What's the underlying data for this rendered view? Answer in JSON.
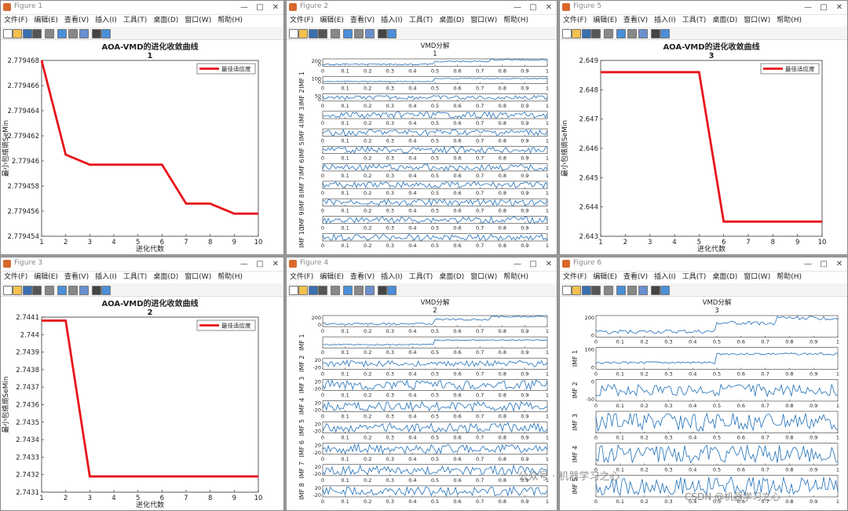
{
  "menu": [
    "文件(F)",
    "编辑(E)",
    "查看(V)",
    "插入(I)",
    "工具(T)",
    "桌面(D)",
    "窗口(W)",
    "帮助(H)"
  ],
  "colors": {
    "conv": "#e8151b",
    "imf": "#1f6fb8",
    "ax": "#333333"
  },
  "figures": [
    {
      "id": "fig1",
      "window_title": "Figure 1",
      "type": "convergence",
      "title": "AOA-VMD的进化收敛曲线",
      "subtitle": "1",
      "xlabel": "进化代数",
      "ylabel": "最小包络熵SeMin",
      "legend": "最佳适应度",
      "legend_position": "top-right",
      "x_ticks": [
        "1",
        "2",
        "3",
        "4",
        "5",
        "6",
        "7",
        "8",
        "9",
        "10"
      ],
      "y_ticks": [
        "2.779468",
        "2.779466",
        "2.779464",
        "2.779462",
        "2.77946",
        "2.779458",
        "2.779456",
        "2.779454"
      ],
      "chart_data": {
        "type": "line",
        "x": [
          1,
          2,
          3,
          4,
          5,
          6,
          7,
          8,
          9,
          10
        ],
        "y": [
          2.779468,
          2.7794605,
          2.7794597,
          2.7794597,
          2.7794597,
          2.7794597,
          2.7794566,
          2.7794566,
          2.7794558,
          2.7794558
        ],
        "ylim": [
          2.779454,
          2.779468
        ]
      }
    },
    {
      "id": "fig2",
      "window_title": "Figure 2",
      "type": "vmd",
      "title": "VMD分解",
      "subtitle": "1",
      "rows": [
        {
          "label": "",
          "ticks": [
            "200",
            "0"
          ]
        },
        {
          "label": "IMF 1",
          "ticks": [
            "100",
            "0"
          ]
        },
        {
          "label": "IMF 2",
          "ticks": [
            "50",
            "0"
          ]
        },
        {
          "label": "IMF 3",
          "ticks": [
            "",
            ""
          ]
        },
        {
          "label": "IMF 4",
          "ticks": [
            "",
            ""
          ]
        },
        {
          "label": "IMF 5",
          "ticks": [
            "",
            ""
          ]
        },
        {
          "label": "IMF 6",
          "ticks": [
            "",
            ""
          ]
        },
        {
          "label": "IMF 7",
          "ticks": [
            "",
            ""
          ]
        },
        {
          "label": "IMF 8",
          "ticks": [
            "",
            ""
          ]
        },
        {
          "label": "IMF 9",
          "ticks": [
            "",
            ""
          ]
        },
        {
          "label": "IMF 10",
          "ticks": [
            "",
            ""
          ]
        }
      ],
      "x_ticks": [
        "0",
        "0.1",
        "0.2",
        "0.3",
        "0.4",
        "0.5",
        "0.6",
        "0.7",
        "0.8",
        "0.9",
        "1"
      ]
    },
    {
      "id": "fig5",
      "window_title": "Figure 5",
      "type": "convergence",
      "title": "AOA-VMD的进化收敛曲线",
      "subtitle": "3",
      "xlabel": "进化代数",
      "ylabel": "最小包络熵SeMin",
      "legend": "最佳适应度",
      "legend_position": "top-right",
      "x_ticks": [
        "1",
        "2",
        "3",
        "4",
        "5",
        "6",
        "7",
        "8",
        "9",
        "10"
      ],
      "y_ticks": [
        "2.649",
        "2.648",
        "2.647",
        "2.646",
        "2.645",
        "2.644",
        "2.643"
      ],
      "chart_data": {
        "type": "line",
        "x": [
          1,
          2,
          3,
          4,
          5,
          6,
          7,
          8,
          9,
          10
        ],
        "y": [
          2.6486,
          2.6486,
          2.6486,
          2.6486,
          2.6486,
          2.6435,
          2.6435,
          2.6435,
          2.6435,
          2.6435
        ],
        "ylim": [
          2.643,
          2.649
        ]
      }
    },
    {
      "id": "fig3",
      "window_title": "Figure 3",
      "type": "convergence",
      "title": "AOA-VMD的进化收敛曲线",
      "subtitle": "2",
      "xlabel": "进化代数",
      "ylabel": "最小包络熵SeMin",
      "legend": "最佳适应度",
      "legend_position": "top-right",
      "x_ticks": [
        "1",
        "2",
        "3",
        "4",
        "5",
        "6",
        "7",
        "8",
        "9",
        "10"
      ],
      "y_ticks": [
        "2.7441",
        "2.744",
        "2.7439",
        "2.7438",
        "2.7437",
        "2.7436",
        "2.7435",
        "2.7434",
        "2.7433",
        "2.7432",
        "2.7431"
      ],
      "chart_data": {
        "type": "line",
        "x": [
          1,
          2,
          3,
          4,
          5,
          6,
          7,
          8,
          9,
          10
        ],
        "y": [
          2.74408,
          2.74408,
          2.74319,
          2.74319,
          2.74319,
          2.74319,
          2.74319,
          2.74319,
          2.74319,
          2.74319
        ],
        "ylim": [
          2.7431,
          2.7441
        ]
      }
    },
    {
      "id": "fig4",
      "window_title": "Figure 4",
      "type": "vmd",
      "title": "VMD分解",
      "subtitle": "2",
      "rows": [
        {
          "label": "",
          "ticks": [
            "200",
            "0"
          ]
        },
        {
          "label": "IMF 1",
          "ticks": [
            "",
            ""
          ]
        },
        {
          "label": "IMF 2",
          "ticks": [
            "20",
            "-20"
          ]
        },
        {
          "label": "IMF 3",
          "ticks": [
            "20",
            "-20"
          ]
        },
        {
          "label": "IMF 4",
          "ticks": [
            "20",
            "-20"
          ]
        },
        {
          "label": "IMF 5",
          "ticks": [
            "20",
            "-20"
          ]
        },
        {
          "label": "IMF 6",
          "ticks": [
            "20",
            "-20"
          ]
        },
        {
          "label": "IMF 7",
          "ticks": [
            "20",
            "-20"
          ]
        },
        {
          "label": "IMF 8",
          "ticks": [
            "20",
            "-20"
          ]
        }
      ],
      "x_ticks": [
        "0",
        "0.1",
        "0.2",
        "0.3",
        "0.4",
        "0.5",
        "0.6",
        "0.7",
        "0.8",
        "0.9",
        "1"
      ]
    },
    {
      "id": "fig6",
      "window_title": "Figure 6",
      "type": "vmd",
      "title": "VMD分解",
      "subtitle": "3",
      "rows": [
        {
          "label": "",
          "ticks": [
            "200",
            "0"
          ]
        },
        {
          "label": "IMF 1",
          "ticks": [
            "100",
            "0"
          ]
        },
        {
          "label": "IMF 2",
          "ticks": [
            "0",
            "-50"
          ]
        },
        {
          "label": "IMF 3",
          "ticks": [
            "",
            ""
          ]
        },
        {
          "label": "IMF 4",
          "ticks": [
            "",
            ""
          ]
        },
        {
          "label": "IMF 5",
          "ticks": [
            "",
            ""
          ]
        }
      ],
      "x_ticks": [
        "0",
        "0.1",
        "0.2",
        "0.3",
        "0.4",
        "0.5",
        "0.6",
        "0.7",
        "0.8",
        "0.9",
        "1"
      ]
    }
  ],
  "watermark": {
    "wechat": "公众号 · 机器学习之心",
    "csdn": "CSDN @机器学习之心"
  }
}
